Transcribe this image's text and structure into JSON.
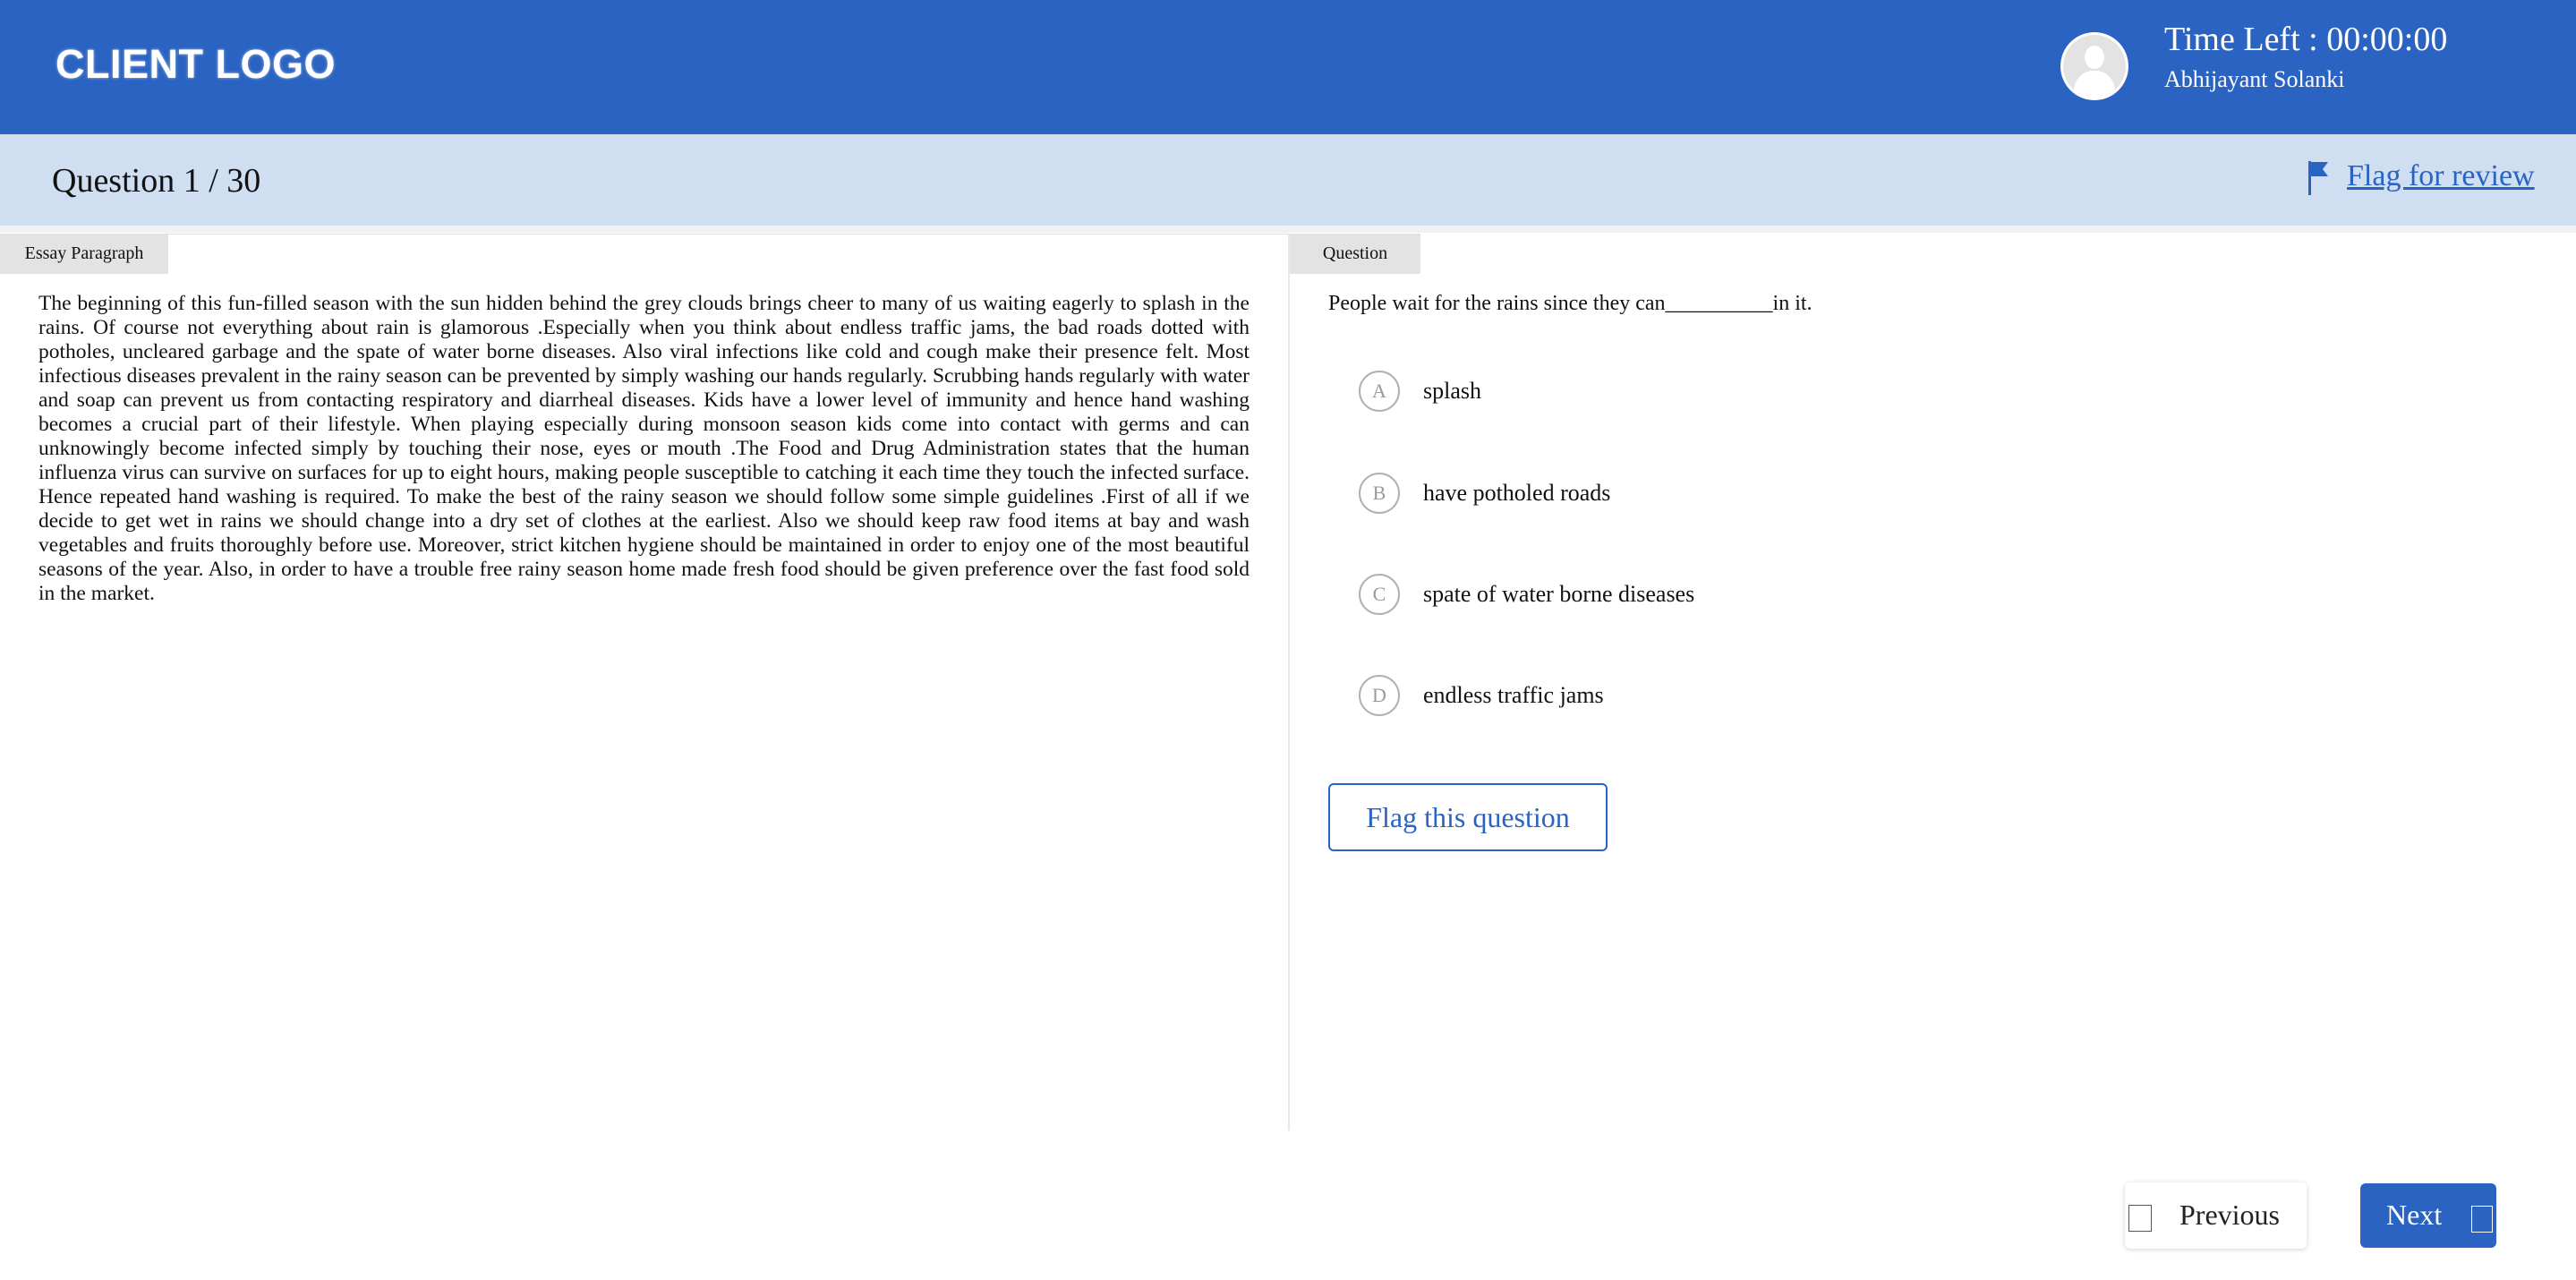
{
  "header": {
    "logo_text": "CLIENT LOGO",
    "time_left": "Time Left : 00:00:00",
    "user_name": "Abhijayant Solanki",
    "avatar_icon": "user-avatar-icon",
    "background_color": "#2a63c2"
  },
  "subheader": {
    "question_count": "Question 1 / 30",
    "flag_review_label": "Flag for review",
    "flag_icon": "flag-icon",
    "background_color": "#cfdef0"
  },
  "essay_panel": {
    "tab_label": "Essay Paragraph",
    "text": "The beginning of this fun-filled season with the sun hidden behind the grey clouds brings cheer to many of us waiting eagerly to splash in the rains. Of course not everything about rain is glamorous .Especially when you think about endless traffic jams, the bad roads dotted with potholes, uncleared garbage and the spate of water borne diseases. Also viral infections like cold and cough make their presence felt. Most infectious diseases prevalent in the rainy season can be prevented by simply washing our hands regularly. Scrubbing hands regularly with water and soap can prevent us from contacting respiratory and diarrheal diseases. Kids have a lower level of immunity and hence hand washing becomes a crucial part of their lifestyle. When playing especially during monsoon season kids come into contact with germs and can unknowingly become infected simply by touching their nose, eyes or mouth .The Food and Drug Administration states that the human influenza virus can survive on surfaces for up to eight hours, making people susceptible to catching it each time they touch the infected surface. Hence repeated hand washing is required. To make the best of the rainy season we should follow some simple guidelines .First of all if we decide to get wet in rains we should change into a dry set of clothes at the earliest. Also we should keep raw food items at bay and wash vegetables and fruits thoroughly before use. Moreover, strict kitchen hygiene should be maintained in order to enjoy one of the most beautiful seasons of the year. Also, in order to have a trouble free rainy season home made fresh food should be given preference over the fast food sold in the market."
  },
  "question_panel": {
    "tab_label": "Question",
    "question_text": "People wait for the rains since they can__________in it.",
    "options": [
      {
        "letter": "A",
        "text": "splash"
      },
      {
        "letter": "B",
        "text": "have potholed roads"
      },
      {
        "letter": "C",
        "text": "spate of water borne diseases"
      },
      {
        "letter": "D",
        "text": "endless traffic jams"
      }
    ],
    "flag_question_label": "Flag this question"
  },
  "footer": {
    "previous_label": "Previous",
    "next_label": "Next",
    "accent_color": "#2a63c2"
  }
}
